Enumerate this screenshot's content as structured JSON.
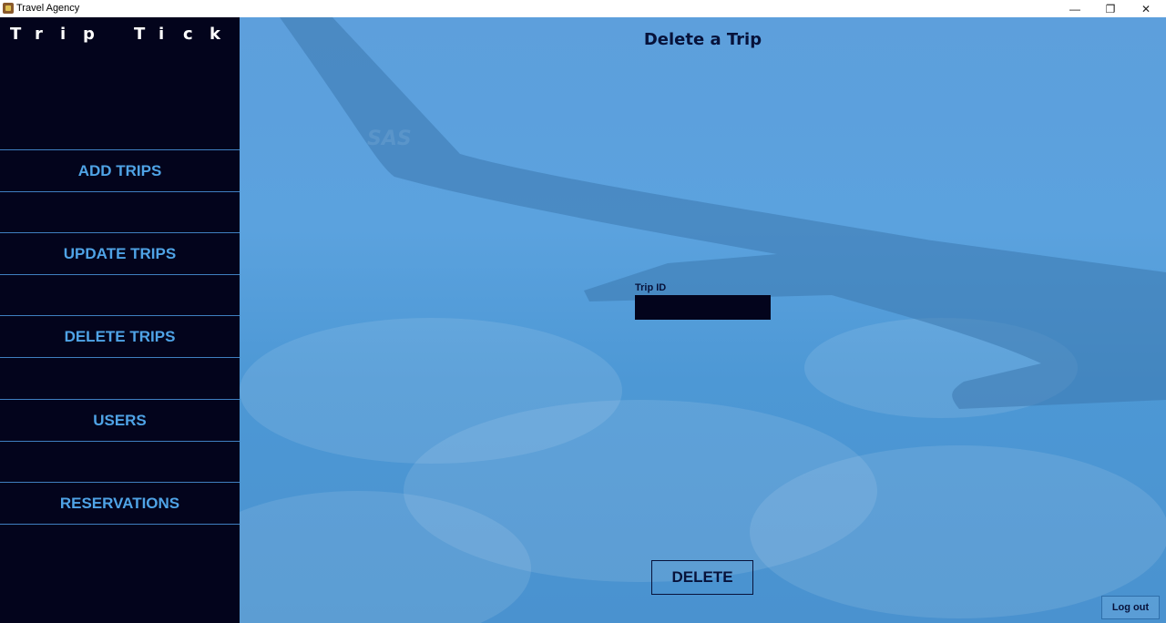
{
  "window": {
    "title": "Travel Agency",
    "minimize": "—",
    "maximize": "❐",
    "close": "✕"
  },
  "sidebar": {
    "brand_letters": [
      "T",
      "r",
      "i",
      "p",
      "T",
      "i",
      "c",
      "k"
    ],
    "items": [
      {
        "label": "ADD TRIPS"
      },
      {
        "label": "UPDATE TRIPS"
      },
      {
        "label": "DELETE TRIPS"
      },
      {
        "label": "USERS"
      },
      {
        "label": "RESERVATIONS"
      }
    ]
  },
  "main": {
    "title": "Delete a Trip",
    "trip_id_label": "Trip ID",
    "trip_id_value": "",
    "delete_label": "DELETE",
    "logout_label": "Log out",
    "wing_logo": "SAS"
  },
  "colors": {
    "sidebar_bg": "#03041c",
    "nav_text": "#4fa3e6",
    "nav_border": "#3f7fc0",
    "main_bg": "#5ba2de",
    "title_text": "#07123a"
  }
}
